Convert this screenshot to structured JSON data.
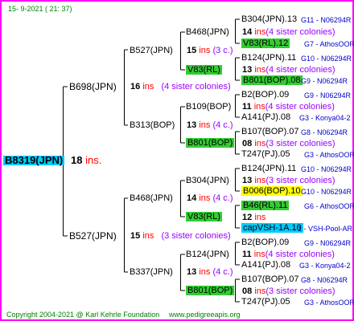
{
  "header": {
    "date": "15-  9-2021 (  21:  37)"
  },
  "footer": {
    "copyright": "Copyright 2004-2021 @ Karl Kehrle Foundation",
    "site": "www.pedigreeapis.org"
  },
  "colors": {
    "border": "#ff00ff",
    "root_bg": "#00ccff",
    "green_box": "#33cc33",
    "yellow_box": "#ffff00",
    "cyan_box": "#00ccff",
    "ins": "#ff0000",
    "sisters": "#9900ff",
    "codes": "#0000cc",
    "footer": "#008000"
  },
  "root": {
    "name": "B8319(JPN)",
    "count": "18",
    "ins": "ins."
  },
  "gen1": [
    {
      "name": "B698(JPN)",
      "count": "16",
      "ins": "ins",
      "sisters": "(4 sister colonies)"
    },
    {
      "name": "B527(JPN)",
      "count": "15",
      "ins": "ins",
      "sisters": "(3 sister colonies)"
    }
  ],
  "gen2": [
    {
      "name": "B527(JPN)",
      "count": "15",
      "ins": "ins",
      "sisters": "(3 c.)"
    },
    {
      "name": "B313(BOP)",
      "count": "13",
      "ins": "ins",
      "sisters": "(4 c.)"
    },
    {
      "name": "B468(JPN)",
      "count": "14",
      "ins": "ins",
      "sisters": "(4 c.)"
    },
    {
      "name": "B337(JPN)",
      "count": "13",
      "ins": "ins",
      "sisters": "(4 c.)"
    }
  ],
  "gen3": [
    {
      "name": "B468(JPN)"
    },
    {
      "name": "V83(RL)"
    },
    {
      "name": "B109(BOP)"
    },
    {
      "name": "B801(BOP)"
    },
    {
      "name": "B304(JPN)"
    },
    {
      "name": "V83(RL)"
    },
    {
      "name": "B124(JPN)"
    },
    {
      "name": "B801(BOP)"
    }
  ],
  "gen4": [
    {
      "name": "B304(JPN).13",
      "code": "G11 - N06294R",
      "count": "14",
      "ins": "ins",
      "sisters": "(4 sister colonies)"
    },
    {
      "name": "V83(RL).12",
      "code": "G7 - AthosOOR"
    },
    {
      "name": "B124(JPN).11",
      "code": "G10 - N06294R",
      "count": "13",
      "ins": "ins",
      "sisters": "(4 sister colonies)"
    },
    {
      "name": "B801(BOP).08",
      "code": "G9 - N06294R"
    },
    {
      "name": "B2(BOP).09",
      "code": "G9 - N06294R",
      "count": "11",
      "ins": "ins",
      "sisters": "(4 sister colonies)"
    },
    {
      "name": "A141(PJ).08",
      "code": "G3 - Konya04-2"
    },
    {
      "name": "B107(BOP).07",
      "code": "G8 - N06294R",
      "count": "08",
      "ins": "ins",
      "sisters": "(3 sister colonies)"
    },
    {
      "name": "T247(PJ).05",
      "code": "G3 - AthosOOR"
    },
    {
      "name": "B124(JPN).11",
      "code": "G10 - N06294R",
      "count": "13",
      "ins": "ins",
      "sisters": "(3 sister colonies)"
    },
    {
      "name": "B006(BOP).10",
      "code": "G10 - N06294R"
    },
    {
      "name": "B46(RL).11",
      "code": "G6 - AthosOOR",
      "count": "12",
      "ins": "ins",
      "sisters": ""
    },
    {
      "name": "capVSH-1A.10",
      "code": "1 - VSH-Pool-AR"
    },
    {
      "name": "B2(BOP).09",
      "code": "G9 - N06294R",
      "count": "11",
      "ins": "ins",
      "sisters": "(4 sister colonies)"
    },
    {
      "name": "A141(PJ).08",
      "code": "G3 - Konya04-2"
    },
    {
      "name": "B107(BOP).07",
      "code": "G8 - N06294R",
      "count": "08",
      "ins": "ins",
      "sisters": "(3 sister colonies)"
    },
    {
      "name": "T247(PJ).05",
      "code": "G3 - AthosOOR"
    }
  ]
}
